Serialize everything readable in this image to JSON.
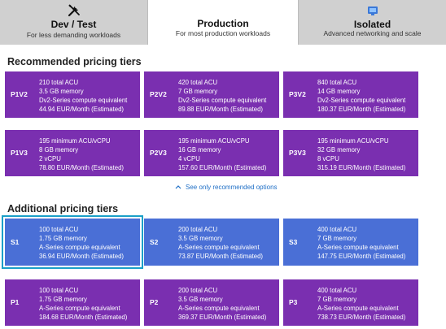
{
  "tabs": [
    {
      "title": "Dev / Test",
      "subtitle": "For less demanding workloads",
      "icon": "tools-icon"
    },
    {
      "title": "Production",
      "subtitle": "For most production workloads"
    },
    {
      "title": "Isolated",
      "subtitle": "Advanced networking and scale",
      "icon": "shield-network-icon"
    }
  ],
  "recommended": {
    "title": "Recommended pricing tiers",
    "tiles": [
      {
        "name": "P1V2",
        "lines": [
          "210 total ACU",
          "3.5 GB memory",
          "Dv2-Series compute equivalent",
          "44.94 EUR/Month (Estimated)"
        ]
      },
      {
        "name": "P2V2",
        "lines": [
          "420 total ACU",
          "7 GB memory",
          "Dv2-Series compute equivalent",
          "89.88 EUR/Month (Estimated)"
        ]
      },
      {
        "name": "P3V2",
        "lines": [
          "840 total ACU",
          "14 GB memory",
          "Dv2-Series compute equivalent",
          "180.37 EUR/Month (Estimated)"
        ]
      },
      {
        "name": "P1V3",
        "lines": [
          "195 minimum ACU/vCPU",
          "8 GB memory",
          "2 vCPU",
          "78.80 EUR/Month (Estimated)"
        ]
      },
      {
        "name": "P2V3",
        "lines": [
          "195 minimum ACU/vCPU",
          "16 GB memory",
          "4 vCPU",
          "157.60 EUR/Month (Estimated)"
        ]
      },
      {
        "name": "P3V3",
        "lines": [
          "195 minimum ACU/vCPU",
          "32 GB memory",
          "8 vCPU",
          "315.19 EUR/Month (Estimated)"
        ]
      }
    ],
    "link": "See only recommended options"
  },
  "additional": {
    "title": "Additional pricing tiers",
    "tiles": [
      {
        "name": "S1",
        "lines": [
          "100 total ACU",
          "1.75 GB memory",
          "A-Series compute equivalent",
          "36.94 EUR/Month (Estimated)"
        ]
      },
      {
        "name": "S2",
        "lines": [
          "200 total ACU",
          "3.5 GB memory",
          "A-Series compute equivalent",
          "73.87 EUR/Month (Estimated)"
        ]
      },
      {
        "name": "S3",
        "lines": [
          "400 total ACU",
          "7 GB memory",
          "A-Series compute equivalent",
          "147.75 EUR/Month (Estimated)"
        ]
      },
      {
        "name": "P1",
        "lines": [
          "100 total ACU",
          "1.75 GB memory",
          "A-Series compute equivalent",
          "184.68 EUR/Month (Estimated)"
        ]
      },
      {
        "name": "P2",
        "lines": [
          "200 total ACU",
          "3.5 GB memory",
          "A-Series compute equivalent",
          "369.37 EUR/Month (Estimated)"
        ]
      },
      {
        "name": "P3",
        "lines": [
          "400 total ACU",
          "7 GB memory",
          "A-Series compute equivalent",
          "738.73 EUR/Month (Estimated)"
        ]
      }
    ]
  },
  "colors": {
    "premium": "#7a2fb0",
    "standard": "#4a6fd6",
    "selected_border": "#1aa0c8",
    "link": "#1f6fc6"
  }
}
